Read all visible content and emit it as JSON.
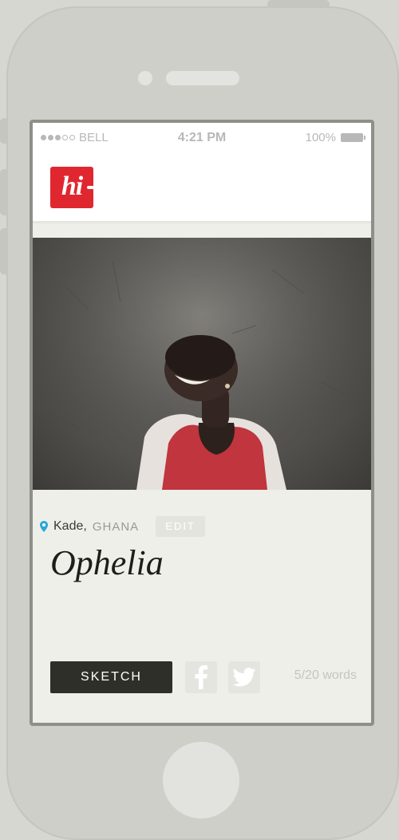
{
  "status_bar": {
    "carrier": "BELL",
    "time": "4:21 PM",
    "battery": "100%",
    "signal_bars_filled": 3,
    "signal_bars_total": 5
  },
  "app": {
    "logo_text": "hi",
    "brand_color": "#e0272f"
  },
  "photo": {
    "subject": "portrait-photo"
  },
  "location": {
    "city": "Kade,",
    "country": "GHANA",
    "edit_label": "EDIT"
  },
  "entry": {
    "title": "Ophelia"
  },
  "actions": {
    "sketch_label": "SKETCH",
    "share_icons": [
      "facebook-icon",
      "twitter-icon"
    ],
    "word_count": "5/20 words"
  },
  "colors": {
    "device_body": "#cfcfca",
    "screen_background": "#efefea",
    "sketch_button": "#2f2f29",
    "location_pin": "#2aa8d8"
  }
}
